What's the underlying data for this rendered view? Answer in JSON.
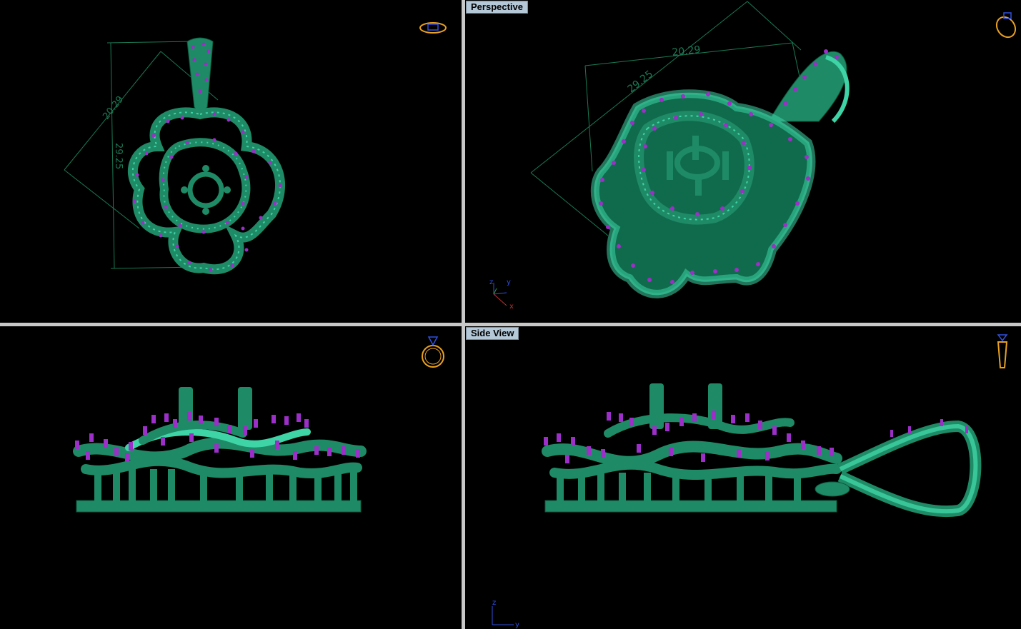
{
  "viewports": {
    "top": {
      "label": ""
    },
    "perspective": {
      "label": "Perspective"
    },
    "front": {
      "label": ""
    },
    "side": {
      "label": "Side View"
    }
  },
  "dimensions": {
    "top_diag": "20.29",
    "top_vert": "29.25",
    "persp_a": "20.29",
    "persp_b": "29.25"
  },
  "axes": {
    "perspective": {
      "y": "y",
      "z": "z",
      "x": "x"
    },
    "side": {
      "z": "z",
      "y": "y"
    }
  },
  "icons": {
    "top": "ring-top-view-icon",
    "perspective": "ring-perspective-icon",
    "front": "ring-front-view-icon",
    "side": "ring-side-view-icon"
  },
  "colors": {
    "metal": "#1f8a66",
    "metal_light": "#3ed4a6",
    "gem": "#9b2fc7",
    "dim_line": "#1a7a55",
    "nav_icon": "#e8a020",
    "border": "#c8c8c8"
  }
}
